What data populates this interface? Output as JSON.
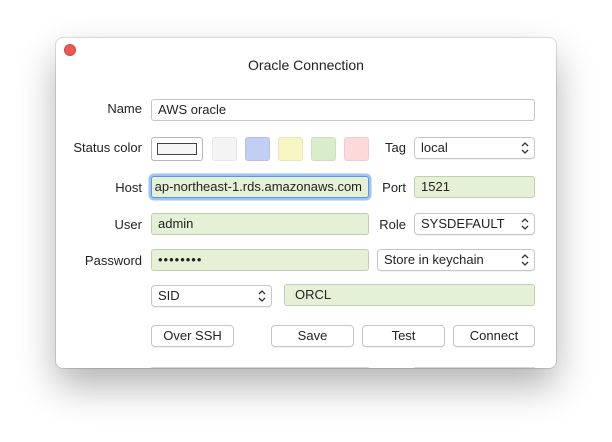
{
  "window": {
    "title": "Oracle Connection"
  },
  "labels": {
    "name": "Name",
    "status_color": "Status color",
    "tag": "Tag",
    "host": "Host",
    "port": "Port",
    "user": "User",
    "role": "Role",
    "password": "Password"
  },
  "fields": {
    "name": "AWS oracle",
    "host": "ap-northeast-1.rds.amazonaws.com",
    "port": "1521",
    "user": "admin",
    "password": "••••••••",
    "sid_value": "ORCL"
  },
  "selects": {
    "tag": "local",
    "role": "SYSDEFAULT",
    "password_storage": "Store in keychain",
    "connection_type": "SID"
  },
  "status_colors": [
    "#f4f4f4",
    "#c3cef5",
    "#f8f5c5",
    "#d9edcb",
    "#fdd9d9"
  ],
  "buttons": {
    "over_ssh": "Over SSH",
    "save": "Save",
    "test": "Test",
    "connect": "Connect"
  }
}
